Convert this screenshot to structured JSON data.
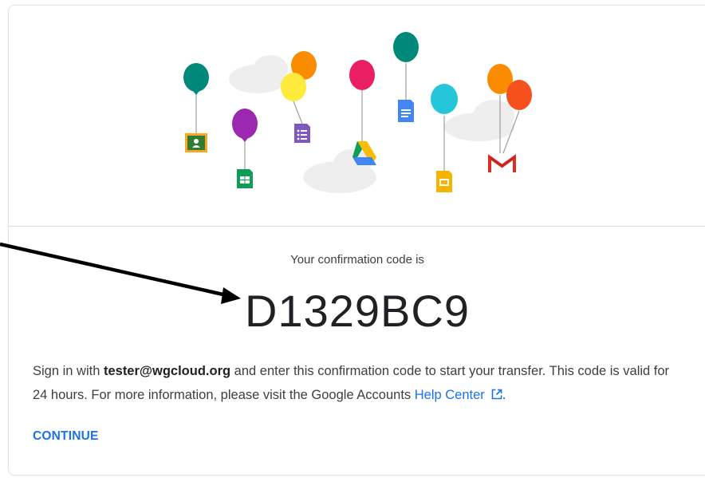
{
  "confirmation": {
    "label": "Your confirmation code is",
    "code": "D1329BC9"
  },
  "message": {
    "prefix": "Sign in with ",
    "email": "tester@wgcloud.org",
    "middle": " and enter this confirmation code to start your transfer. This code is valid for 24 hours. For more information, please visit the Google Accounts ",
    "link_text": "Help Center",
    "suffix": "."
  },
  "actions": {
    "continue_label": "CONTINUE"
  },
  "colors": {
    "link": "#1a73e8",
    "arrow": "#000000"
  },
  "illustration": {
    "icons": [
      "classroom-icon",
      "sheets-icon",
      "forms-icon",
      "drive-icon",
      "docs-icon",
      "slides-icon",
      "gmail-icon"
    ]
  }
}
